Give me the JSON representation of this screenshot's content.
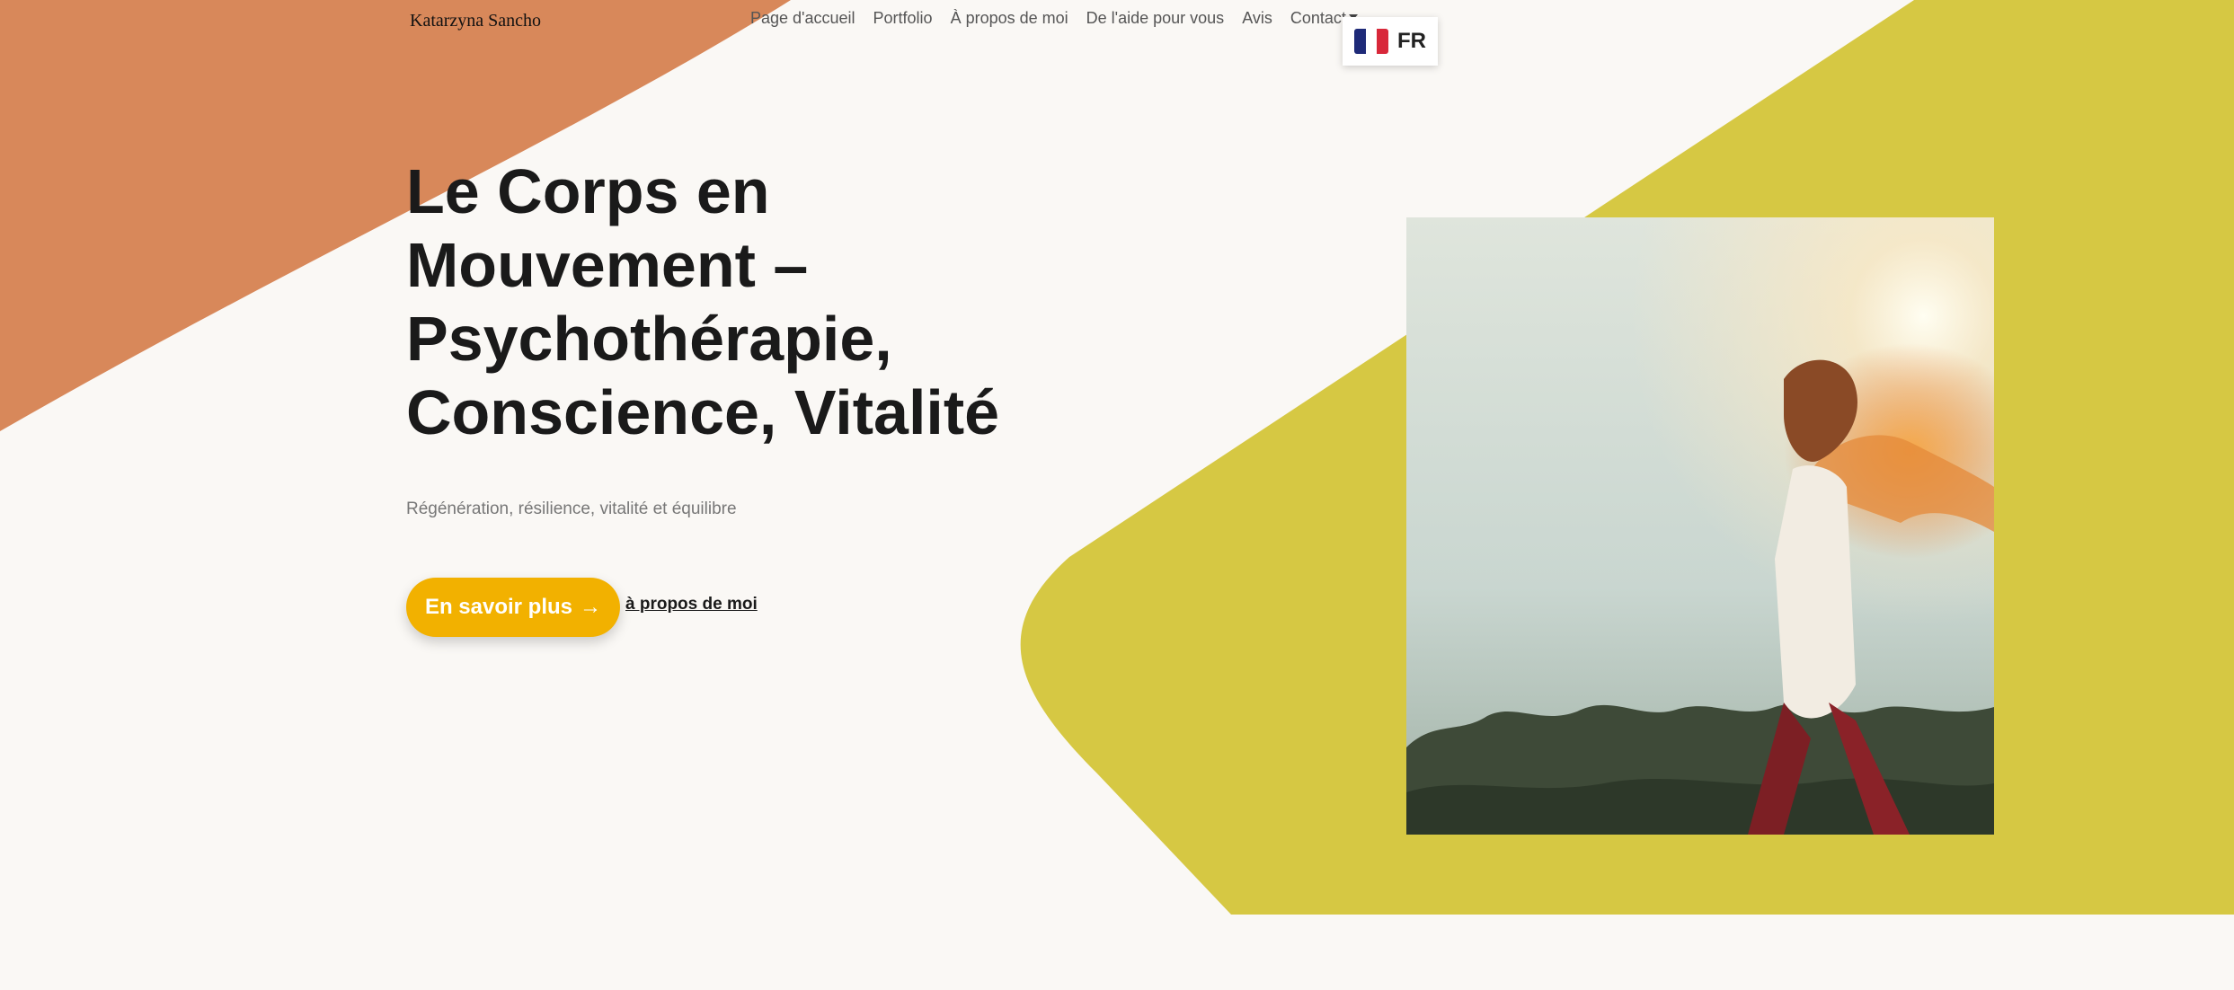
{
  "brand": {
    "name": "Katarzyna Sancho"
  },
  "nav": {
    "items": [
      {
        "label": "Page d'accueil"
      },
      {
        "label": "Portfolio"
      },
      {
        "label": "À propos de moi"
      },
      {
        "label": "De l'aide pour vous"
      },
      {
        "label": "Avis"
      },
      {
        "label": "Contact"
      }
    ]
  },
  "language": {
    "code": "FR",
    "flag_icon": "france-flag-icon"
  },
  "hero": {
    "title": "Le Corps en Mouvement – Psychothérapie, Conscience, Vitalité",
    "subtitle": "Régénération, résilience, vitalité et équilibre",
    "cta_label": "En savoir plus",
    "cta_icon": "arrow-right-icon",
    "secondary_link": "à propos de moi",
    "image_icon": "woman-running-sunset-photo"
  },
  "colors": {
    "background": "#faf8f5",
    "orange_shape": "#d8885a",
    "yellow_shape": "#d6c843",
    "cta": "#f2b100",
    "text": "#1a1a1a"
  }
}
